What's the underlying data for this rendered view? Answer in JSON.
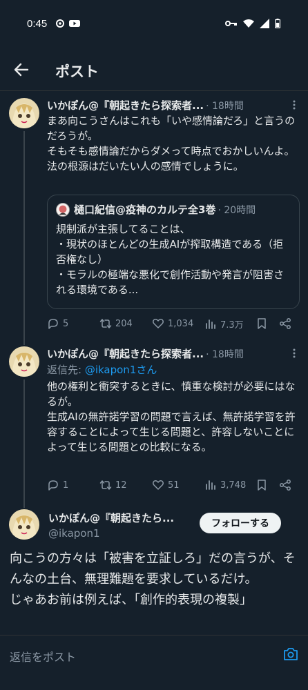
{
  "status": {
    "time": "0:45"
  },
  "header": {
    "title": "ポスト"
  },
  "tweets": [
    {
      "name": "いかぽん@『朝起きたら探索者...",
      "time": "· 18時間",
      "text": "まあ向こうさんはこれも「いや感情論だろ」と言うのだろうが。\nそもそも感情論だからダメって時点でおかしいんよ。\n法の根源はだいたい人の感情でしょうに。",
      "quote": {
        "name": "樋口紀信@疫神のカルテ全3巻",
        "time": "· 20時間",
        "text": "規制派が主張してることは、\n・現状のほとんどの生成AIが搾取構造である（拒否権なし）\n・モラルの極端な悪化で創作活動や発言が阻害される環境である..."
      },
      "replies": "5",
      "reposts": "204",
      "likes": "1,034",
      "views": "7.3万"
    },
    {
      "name": "いかぽん@『朝起きたら探索者...",
      "time": "· 18時間",
      "reply_prefix": "返信先: ",
      "reply_handle": "@ikapon1さん",
      "text": "他の権利と衝突するときに、慎重な検討が必要にはなるが。\n生成AIの無許諾学習の問題で言えば、無許諾学習を許容することによって生じる問題と、許容しないことによって生じる問題との比較になる。",
      "replies": "1",
      "reposts": "12",
      "likes": "51",
      "views": "3,748"
    }
  ],
  "main_tweet": {
    "name": "いかぽん@『朝起きたら...",
    "handle": "@ikapon1",
    "follow_label": "フォローする",
    "text": "向こうの方々は「被害を立証しろ」だの言うが、そんなの土台、無理難題を要求しているだけ。\nじゃあお前は例えば、「創作的表現の複製」"
  },
  "reply_bar": {
    "placeholder": "返信をポスト"
  },
  "colors": {
    "background": "#15202b",
    "accent": "#1d9bf0",
    "muted": "#8b98a5"
  },
  "icons": [
    "back-arrow-icon",
    "more-vertical-icon",
    "reply-icon",
    "repost-icon",
    "like-icon",
    "views-icon",
    "bookmark-icon",
    "share-icon",
    "camera-icon"
  ]
}
